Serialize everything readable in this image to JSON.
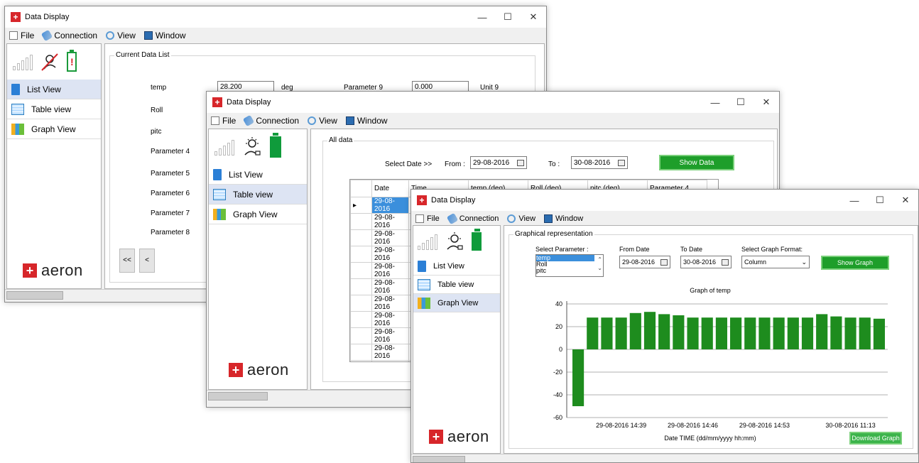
{
  "window1": {
    "title": "Data Display",
    "menu": [
      "File",
      "Connection",
      "View",
      "Window"
    ],
    "nav": [
      "List View",
      "Table view",
      "Graph View"
    ],
    "logo_text": "aeron",
    "group_label": "Current Data List",
    "params_left": [
      "temp",
      "Roll",
      "pitc",
      "Parameter 4",
      "Parameter 5",
      "Parameter 6",
      "Parameter 7",
      "Parameter 8"
    ],
    "temp_value": "28.200",
    "temp_unit": "deg",
    "param9_label": "Parameter 9",
    "param9_value": "0.000",
    "param9_unit": "Unit 9",
    "pager_first": "<<",
    "pager_prev": "<"
  },
  "window2": {
    "title": "Data Display",
    "menu": [
      "File",
      "Connection",
      "View",
      "Window"
    ],
    "nav": [
      "List View",
      "Table view",
      "Graph View"
    ],
    "logo_text": "aeron",
    "group_label": "All data",
    "select_date_label": "Select Date >>",
    "from_label": "From :",
    "from_value": "29-08-2016",
    "to_label": "To :",
    "to_value": "30-08-2016",
    "show_button": "Show Data",
    "columns": [
      "Date",
      "Time",
      "temp (deg)",
      "Roll (deg)",
      "pitc (deg)",
      "Parameter 4"
    ],
    "rows": [
      "29-08-2016",
      "29-08-2016",
      "29-08-2016",
      "29-08-2016",
      "29-08-2016",
      "29-08-2016",
      "29-08-2016",
      "29-08-2016",
      "29-08-2016",
      "29-08-2016",
      "29-08-2016"
    ]
  },
  "window3": {
    "title": "Data Display",
    "menu": [
      "File",
      "Connection",
      "View",
      "Window"
    ],
    "nav": [
      "List View",
      "Table view",
      "Graph View"
    ],
    "logo_text": "aeron",
    "group_label": "Graphical representation",
    "select_param_label": "Select Parameter :",
    "param_options": [
      "temp",
      "Roll",
      "pitc"
    ],
    "from_date_label": "From Date",
    "from_date_value": "29-08-2016",
    "to_date_label": "To Date",
    "to_date_value": "30-08-2016",
    "format_label": "Select Graph Format:",
    "format_value": "Column",
    "show_graph_button": "Show Graph",
    "download_button": "Download Graph"
  },
  "colors": {
    "bar": "#1e8c1e",
    "accent_green": "#1e9e2a",
    "brand_red": "#d7262a",
    "selection": "#3b8fdc"
  },
  "chart_data": {
    "type": "bar",
    "title": "Graph of temp",
    "xlabel": "Date TIME (dd/mm/yyyy hh:mm)",
    "ylabel": "",
    "ylim": [
      -60,
      40
    ],
    "yticks": [
      40,
      20,
      0,
      -20,
      -40,
      -60
    ],
    "xtick_labels": [
      "29-08-2016 14:39",
      "29-08-2016 14:46",
      "29-08-2016 14:53",
      "30-08-2016 11:13"
    ],
    "values": [
      -50,
      28,
      28,
      28,
      32,
      33,
      31,
      30,
      28,
      28,
      28,
      28,
      28,
      28,
      28,
      28,
      28,
      31,
      29,
      28,
      28,
      27
    ]
  }
}
